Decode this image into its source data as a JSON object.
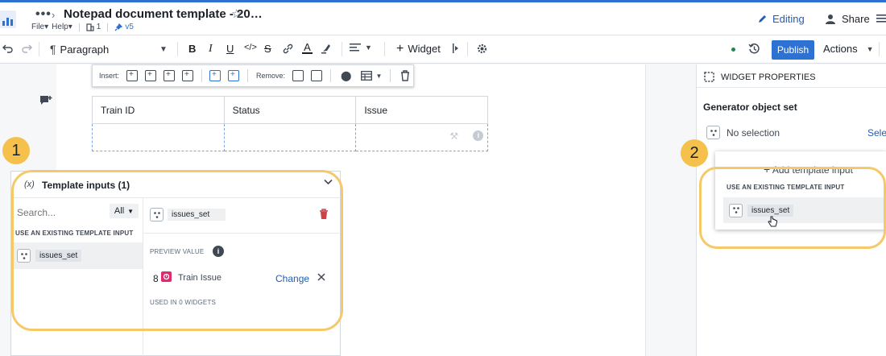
{
  "header": {
    "title": "Notepad document template - 20…",
    "menus": [
      "File",
      "Help"
    ],
    "dependents": "1",
    "version": "v5",
    "editing_label": "Editing",
    "share_label": "Share"
  },
  "toolbar": {
    "paragraph_label": "Paragraph",
    "widget_label": "Widget",
    "publish_label": "Publish",
    "actions_label": "Actions"
  },
  "insert_bar": {
    "insert_label": "Insert:",
    "remove_label": "Remove:"
  },
  "table": {
    "headers": [
      "Train ID",
      "Status",
      "Issue"
    ]
  },
  "template_panel": {
    "icon_text": "(x)",
    "title": "Template inputs (1)",
    "search_placeholder": "Search...",
    "filter_value": "All",
    "section_label": "USE AN EXISTING TEMPLATE INPUT",
    "items": [
      {
        "name": "issues_set"
      }
    ],
    "selected_name": "issues_set",
    "preview_label": "PREVIEW VALUE",
    "preview_count": "8",
    "preview_type": "Train Issue",
    "change_label": "Change",
    "used_in_label": "USED IN 0 WIDGETS"
  },
  "properties": {
    "header": "WIDGET PROPERTIES",
    "generator_label": "Generator object set",
    "no_selection": "No selection",
    "select_link": "Selec",
    "dropdown": {
      "add_label": "Add template input",
      "section_label": "USE AN EXISTING TEMPLATE INPUT",
      "item": "issues_set"
    }
  },
  "callouts": {
    "one": "1",
    "two": "2"
  },
  "colors": {
    "accent": "#2d72d2",
    "callout": "#f5c04b",
    "danger": "#cd4246",
    "object_type": "#db2c6f"
  }
}
